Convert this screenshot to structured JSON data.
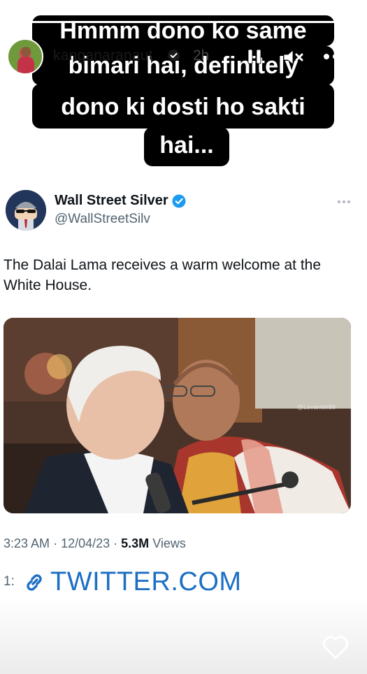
{
  "story": {
    "username": "kanganaranaut",
    "time_ago": "2h",
    "progress": 1.0,
    "caption_lines": [
      "Hmmm dono ko same",
      "bimari hai, definitely",
      "dono ki dosti ho sakti",
      "hai..."
    ],
    "icons": {
      "pause": "pause-icon",
      "mute": "mute-icon",
      "more": "more-icon",
      "like": "heart-icon",
      "verified": "verified-icon"
    }
  },
  "tweet": {
    "author_name": "Wall Street Silver",
    "author_handle": "@WallStreetSilv",
    "text": "The Dalai Lama receives a warm welcome at the White House.",
    "image_watermark": "@Levanteli88",
    "time": "3:23 AM",
    "date": "12/04/23",
    "views_count": "5.3M",
    "views_label": "Views",
    "link_prefix": "1:",
    "link_text": "TWITTER.COM",
    "colors": {
      "link": "#1d6fc4",
      "verified": "#1d9bf0"
    }
  }
}
